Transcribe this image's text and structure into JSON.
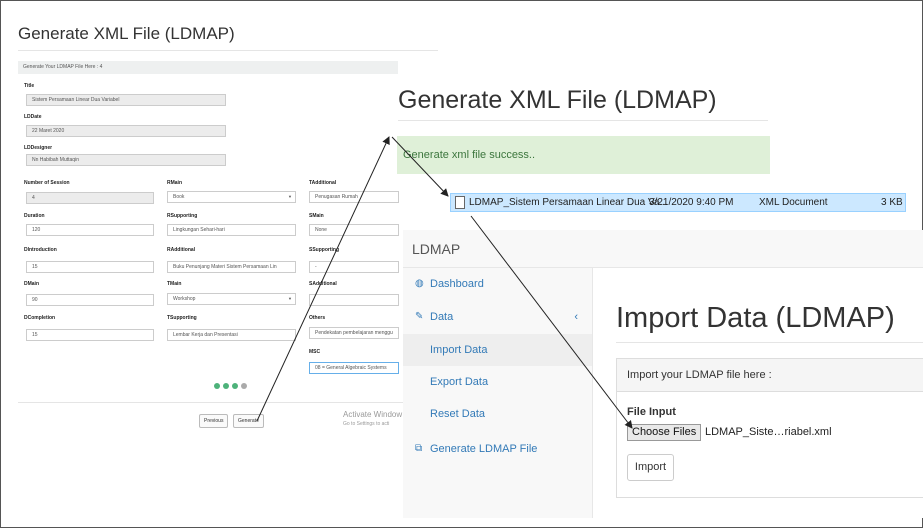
{
  "form": {
    "title": "Generate XML File (LDMAP)",
    "bar_text": "Generate Your LDMAP File Here : 4",
    "title_label": "Title",
    "title_value": "Sistem Persamaan Linear Dua Variabel",
    "lddate_label": "LDDate",
    "lddate_value": "22 Maret 2020",
    "lddesigner_label": "LDDesigner",
    "lddesigner_value": "Nn Habibah Muttaqin",
    "col1": [
      {
        "label": "Number of Session",
        "value": "4"
      },
      {
        "label": "Duration",
        "value": "120"
      },
      {
        "label": "DIntroduction",
        "value": "15"
      },
      {
        "label": "DMain",
        "value": "90"
      },
      {
        "label": "DCompletion",
        "value": "15"
      }
    ],
    "col2": [
      {
        "label": "RMain",
        "value": "Book"
      },
      {
        "label": "RSupporting",
        "value": "Lingkungan Sehari-hari"
      },
      {
        "label": "RAdditional",
        "value": "Buku Penunjang Materi Sistem Persamaan Lin"
      },
      {
        "label": "TMain",
        "value": "Workshop"
      },
      {
        "label": "TSupporting",
        "value": "Lembar Kerja dan Presentasi"
      }
    ],
    "col3": [
      {
        "label": "TAdditional",
        "value": "Penugasan Rumah"
      },
      {
        "label": "SMain",
        "value": "None"
      },
      {
        "label": "SSupporting",
        "value": "-"
      },
      {
        "label": "SAdditional",
        "value": ""
      },
      {
        "label": "Others",
        "value": "Pendekatan pembelajaran menggu"
      }
    ],
    "msc_label": "MSC",
    "msc_value": "08 = General Algebraic Systems",
    "previous_label": "Previous",
    "generate_label": "Generate",
    "wm1": "Activate Window",
    "wm2": "Go to Settings to acti"
  },
  "success": {
    "title": "Generate XML File (LDMAP)",
    "alert": "Generate xml file success.."
  },
  "file": {
    "name": "LDMAP_Sistem Persamaan Linear Dua Va...",
    "date": "3/21/2020 9:40 PM",
    "type": "XML Document",
    "size": "3 KB"
  },
  "admin": {
    "brand": "LDMAP",
    "nav": {
      "dashboard": "Dashboard",
      "data": "Data",
      "import": "Import Data",
      "export": "Export Data",
      "reset": "Reset Data",
      "generate": "Generate LDMAP File"
    },
    "title": "Import Data (LDMAP)",
    "card_head": "Import your LDMAP file here :",
    "file_input_label": "File Input",
    "choose_label": "Choose Files",
    "chosen_file": "LDMAP_Siste…riabel.xml",
    "import_label": "Import"
  },
  "icons": [
    "dashboard-icon",
    "edit-icon",
    "copy-icon",
    "file-icon",
    "chevron-left-icon"
  ],
  "colors": {
    "alert_bg": "#dff0d8",
    "alert_text": "#3c763d",
    "link": "#337ab7",
    "selection": "#cce8ff",
    "step_dot": "#4db27a"
  }
}
